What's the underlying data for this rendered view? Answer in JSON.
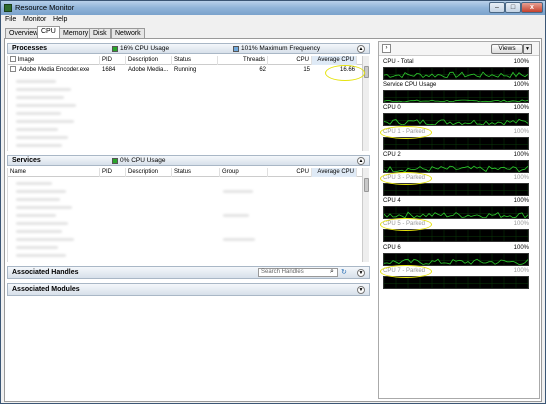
{
  "window": {
    "title": "Resource Monitor",
    "buttons": {
      "minimize": "–",
      "maximize": "□",
      "close": "x"
    }
  },
  "menu": [
    "File",
    "Monitor",
    "Help"
  ],
  "tabs": [
    "Overview",
    "CPU",
    "Memory",
    "Disk",
    "Network"
  ],
  "processes": {
    "title": "Processes",
    "usage": "16% CPU Usage",
    "frequency": "101% Maximum Frequency",
    "columns": [
      "Image",
      "PID",
      "Description",
      "Status",
      "Threads",
      "CPU",
      "Average CPU"
    ],
    "row": {
      "image": "Adobe Media Encoder.exe",
      "pid": "1684",
      "description": "Adobe Media...",
      "status": "Running",
      "threads": "62",
      "cpu": "15",
      "avg": "16.66"
    }
  },
  "services": {
    "title": "Services",
    "usage": "0% CPU Usage",
    "columns": [
      "Name",
      "PID",
      "Description",
      "Status",
      "Group",
      "CPU",
      "Average CPU"
    ]
  },
  "handles": {
    "title": "Associated Handles",
    "search_placeholder": "Search Handles"
  },
  "modules": {
    "title": "Associated Modules"
  },
  "right": {
    "views_label": "Views",
    "graphs": [
      {
        "label": "CPU - Total",
        "pct": "100%",
        "parked": false
      },
      {
        "label": "Service CPU Usage",
        "pct": "100%",
        "parked": false
      },
      {
        "label": "CPU 0",
        "pct": "100%",
        "parked": false
      },
      {
        "label": "CPU 1 - Parked",
        "pct": "100%",
        "parked": true
      },
      {
        "label": "CPU 2",
        "pct": "100%",
        "parked": false
      },
      {
        "label": "CPU 3 - Parked",
        "pct": "100%",
        "parked": true
      },
      {
        "label": "CPU 4",
        "pct": "100%",
        "parked": false
      },
      {
        "label": "CPU 5 - Parked",
        "pct": "100%",
        "parked": true
      },
      {
        "label": "CPU 6",
        "pct": "100%",
        "parked": false
      },
      {
        "label": "CPU 7 - Parked",
        "pct": "100%",
        "parked": true
      }
    ]
  },
  "colors": {
    "graph_line": "#2ecc2e",
    "highlight": "#e5e30f"
  }
}
